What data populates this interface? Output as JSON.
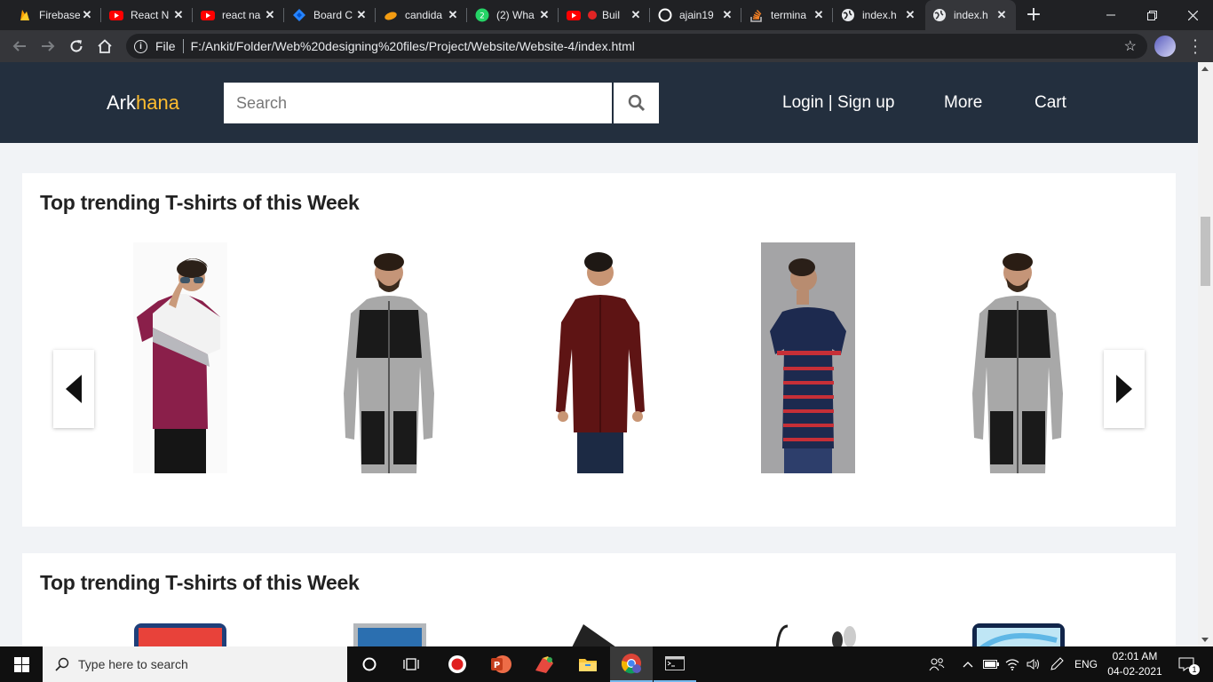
{
  "browser": {
    "tabs": [
      {
        "title": "Firebase",
        "icon": "firebase-icon"
      },
      {
        "title": "React N",
        "icon": "youtube-icon"
      },
      {
        "title": "react na",
        "icon": "youtube-icon"
      },
      {
        "title": "Board C",
        "icon": "jira-icon"
      },
      {
        "title": "candida",
        "icon": "leaf-icon"
      },
      {
        "title": "(2) Wha",
        "icon": "whatsapp-icon"
      },
      {
        "title": "Buil",
        "icon": "youtube-icon"
      },
      {
        "title": "ajain19",
        "icon": "github-icon"
      },
      {
        "title": "termina",
        "icon": "stackoverflow-icon"
      },
      {
        "title": "index.h",
        "icon": "globe-icon"
      },
      {
        "title": "index.h",
        "icon": "globe-icon",
        "active": true
      }
    ],
    "address": {
      "scheme_label": "File",
      "url": "F:/Ankit/Folder/Web%20designing%20files/Project/Website/Website-4/index.html"
    }
  },
  "site": {
    "brand_part1": "Ark",
    "brand_part2": "hana",
    "search_placeholder": "Search",
    "nav": {
      "login": "Login | Sign up",
      "more": "More",
      "cart": "Cart"
    },
    "colors": {
      "header_bg": "#232f3e",
      "brand_accent": "#febd2f"
    }
  },
  "sections": [
    {
      "title": "Top trending T-shirts of this Week",
      "products": [
        {
          "name": "maroon-white-colorblock-tshirt"
        },
        {
          "name": "grey-black-zip-hoodie"
        },
        {
          "name": "maroon-casual-shirt"
        },
        {
          "name": "navy-red-striped-tshirt"
        },
        {
          "name": "grey-black-zip-hoodie"
        }
      ]
    },
    {
      "title": "Top trending T-shirts of this Week"
    }
  ],
  "taskbar": {
    "search_placeholder": "Type here to search",
    "language": "ENG",
    "time": "02:01 AM",
    "date": "04-02-2021",
    "notification_count": "1"
  }
}
